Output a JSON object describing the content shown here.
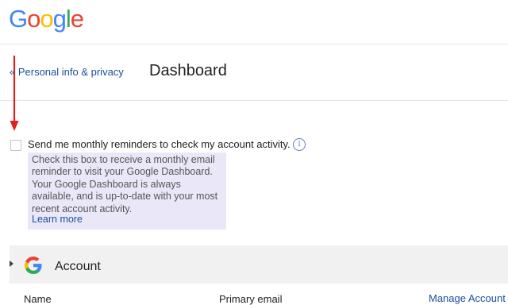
{
  "header": {
    "logo": {
      "letters": [
        "G",
        "o",
        "o",
        "g",
        "l",
        "e"
      ],
      "colors": [
        "#4285f4",
        "#ea4335",
        "#fbbc05",
        "#4285f4",
        "#34a853",
        "#ea4335"
      ]
    }
  },
  "nav": {
    "back_link": "« Personal info & privacy",
    "page_title": "Dashboard"
  },
  "reminder": {
    "checked": false,
    "label": "Send me monthly reminders to check my account activity.",
    "info_icon": "i",
    "help_text": "Check this box to receive a monthly email reminder to visit your Google Dashboard. Your Google Dashboard is always available, and is up-to-date with your most recent account activity.",
    "learn_more": "Learn more"
  },
  "annotation": {
    "arrow_color": "#e0201a"
  },
  "account_section": {
    "title": "Account",
    "icon": "google-g-icon",
    "columns": {
      "name": "Name",
      "primary_email": "Primary email",
      "manage": "Manage Account"
    }
  },
  "colors": {
    "link": "#1a4fa0",
    "help_bg": "#eae8f8",
    "section_bg": "#f1f1f1"
  }
}
